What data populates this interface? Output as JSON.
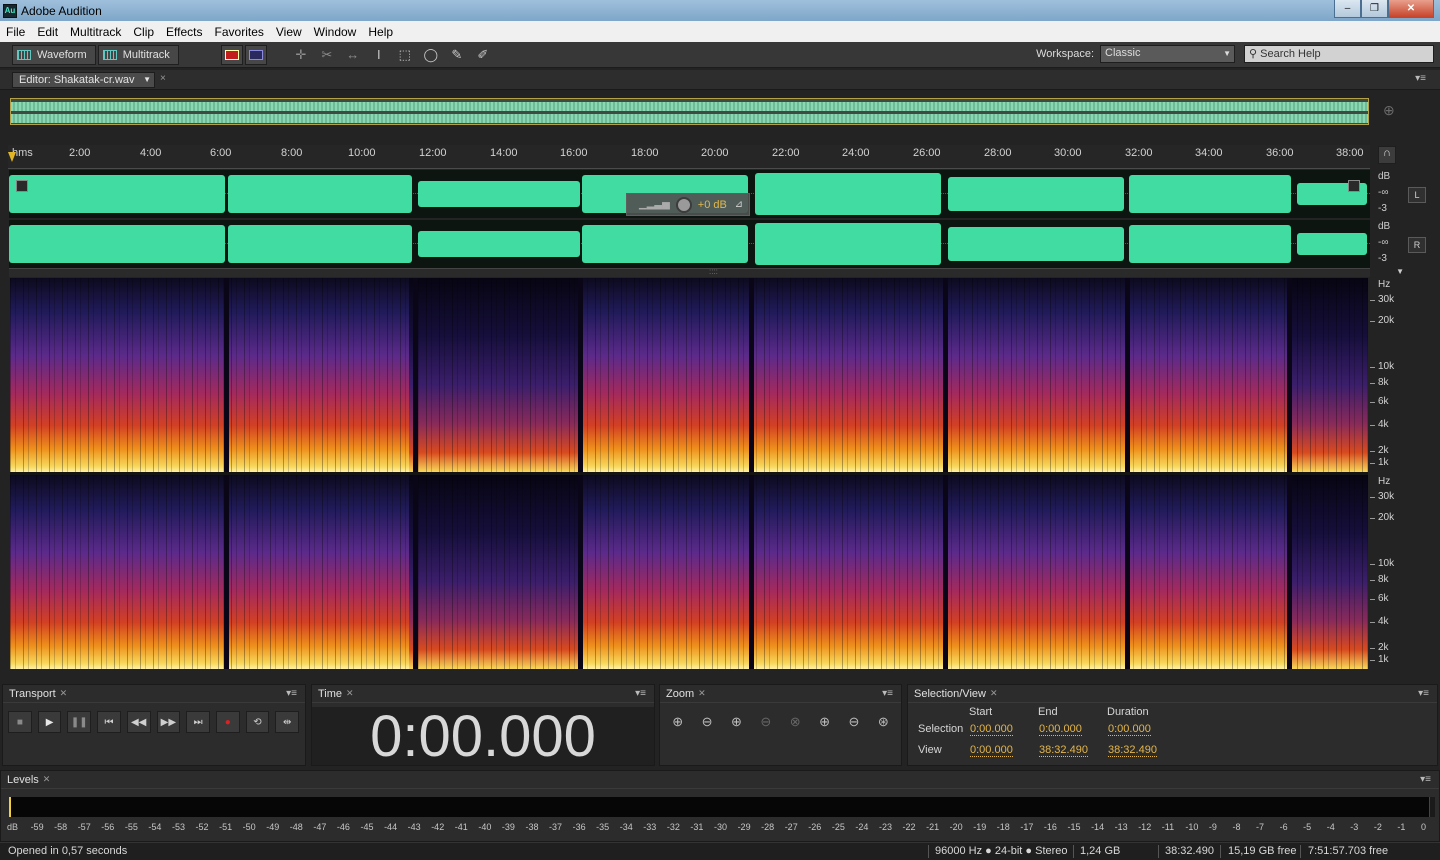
{
  "window": {
    "app_icon": "Au",
    "title": "Adobe Audition",
    "controls": [
      "–",
      "❐",
      "✕"
    ]
  },
  "menubar": [
    "File",
    "Edit",
    "Multitrack",
    "Clip",
    "Effects",
    "Favorites",
    "View",
    "Window",
    "Help"
  ],
  "toolbar": {
    "waveform_label": "Waveform",
    "multitrack_label": "Multitrack",
    "workspace_label": "Workspace:",
    "workspace_value": "Classic",
    "search_placeholder": "Search Help"
  },
  "editor": {
    "tab_label": "Editor: Shakatak-cr.wav",
    "ruler_unit": "hms",
    "ruler_ticks": [
      "2:00",
      "4:00",
      "6:00",
      "8:00",
      "10:00",
      "12:00",
      "14:00",
      "16:00",
      "18:00",
      "20:00",
      "22:00",
      "24:00",
      "26:00",
      "28:00",
      "30:00",
      "32:00",
      "34:00",
      "36:00",
      "38:00"
    ],
    "channel_left": "L",
    "channel_right": "R",
    "amp_scale": [
      "dB",
      "-∞",
      "-3"
    ],
    "hud_gain": "+0 dB",
    "freq_scale": [
      "Hz",
      "30k",
      "20k",
      "10k",
      "8k",
      "6k",
      "4k",
      "2k",
      "1k"
    ]
  },
  "transport": {
    "title": "Transport",
    "buttons": [
      "stop",
      "play",
      "pause",
      "to-start",
      "rewind",
      "fast-forward",
      "to-end",
      "record",
      "loop",
      "skip-selection"
    ]
  },
  "time": {
    "title": "Time",
    "display": "0:00.000"
  },
  "zoom": {
    "title": "Zoom"
  },
  "selection_view": {
    "title": "Selection/View",
    "headers": [
      "Start",
      "End",
      "Duration"
    ],
    "rows": [
      {
        "label": "Selection",
        "start": "0:00.000",
        "end": "0:00.000",
        "duration": "0:00.000"
      },
      {
        "label": "View",
        "start": "0:00.000",
        "end": "38:32.490",
        "duration": "38:32.490"
      }
    ]
  },
  "levels": {
    "title": "Levels",
    "scale": [
      "dB",
      "-59",
      "-58",
      "-57",
      "-56",
      "-55",
      "-54",
      "-53",
      "-52",
      "-51",
      "-50",
      "-49",
      "-48",
      "-47",
      "-46",
      "-45",
      "-44",
      "-43",
      "-42",
      "-41",
      "-40",
      "-39",
      "-38",
      "-37",
      "-36",
      "-35",
      "-34",
      "-33",
      "-32",
      "-31",
      "-30",
      "-29",
      "-28",
      "-27",
      "-26",
      "-25",
      "-24",
      "-23",
      "-22",
      "-21",
      "-20",
      "-19",
      "-18",
      "-17",
      "-16",
      "-15",
      "-14",
      "-13",
      "-12",
      "-11",
      "-10",
      "-9",
      "-8",
      "-7",
      "-6",
      "-5",
      "-4",
      "-3",
      "-2",
      "-1",
      "0"
    ]
  },
  "status": {
    "message": "Opened in 0,57 seconds",
    "format": "96000 Hz ● 24-bit ● Stereo",
    "file_size": "1,24 GB",
    "duration": "38:32.490",
    "disk_free": "15,19 GB free",
    "time_free": "7:51:57.703 free"
  },
  "colors": {
    "waveform": "#40dca1",
    "selection_value": "#e4b54b",
    "accent": "#e2b526"
  }
}
